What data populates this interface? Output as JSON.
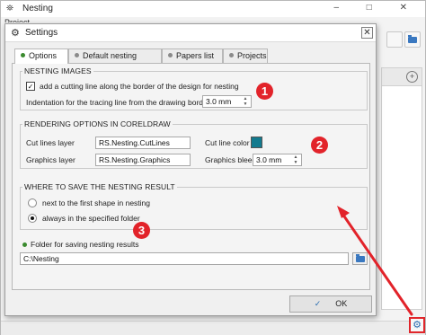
{
  "main_window": {
    "title": "Nesting",
    "menu_label": "Project",
    "controls": "–  □  ✕"
  },
  "dialog": {
    "title": "Settings",
    "close_glyph": "✕",
    "tabs": [
      {
        "label": "Options",
        "active": true
      },
      {
        "label": "Default nesting parameters",
        "active": false
      },
      {
        "label": "Papers list",
        "active": false
      },
      {
        "label": "Projects",
        "active": false
      }
    ],
    "nesting_images": {
      "legend": "NESTING IMAGES",
      "cutting_line_label": "add a cutting line along the border of the design for nesting",
      "cutting_line_checked": true,
      "indentation_label": "Indentation for the tracing line from the drawing border",
      "indentation_value": "3.0 mm"
    },
    "rendering": {
      "legend": "RENDERING OPTIONS IN CORELDRAW",
      "cut_lines_layer_label": "Cut lines layer",
      "cut_lines_layer_value": "RS.Nesting.CutLines",
      "cut_line_color_label": "Cut line color",
      "cut_line_color": "#127a8e",
      "graphics_layer_label": "Graphics layer",
      "graphics_layer_value": "RS.Nesting.Graphics",
      "graphics_bleed_label": "Graphics bleed",
      "graphics_bleed_value": "3.0 mm"
    },
    "save_location": {
      "legend": "WHERE TO SAVE THE NESTING RESULT",
      "options": [
        {
          "label": "next to the first shape in nesting",
          "selected": false
        },
        {
          "label": "always in the specified folder",
          "selected": true
        }
      ]
    },
    "folder": {
      "label": "Folder for saving nesting results",
      "value": "C:\\Nesting"
    },
    "ok_label": "OK"
  },
  "annotations": {
    "badges": [
      "1",
      "2",
      "3"
    ],
    "color": "#e2232a"
  },
  "icons": {
    "app": "nesting-app-icon",
    "settings": "gear-icon",
    "folder": "folder-icon",
    "ok": "checkmark-icon"
  }
}
